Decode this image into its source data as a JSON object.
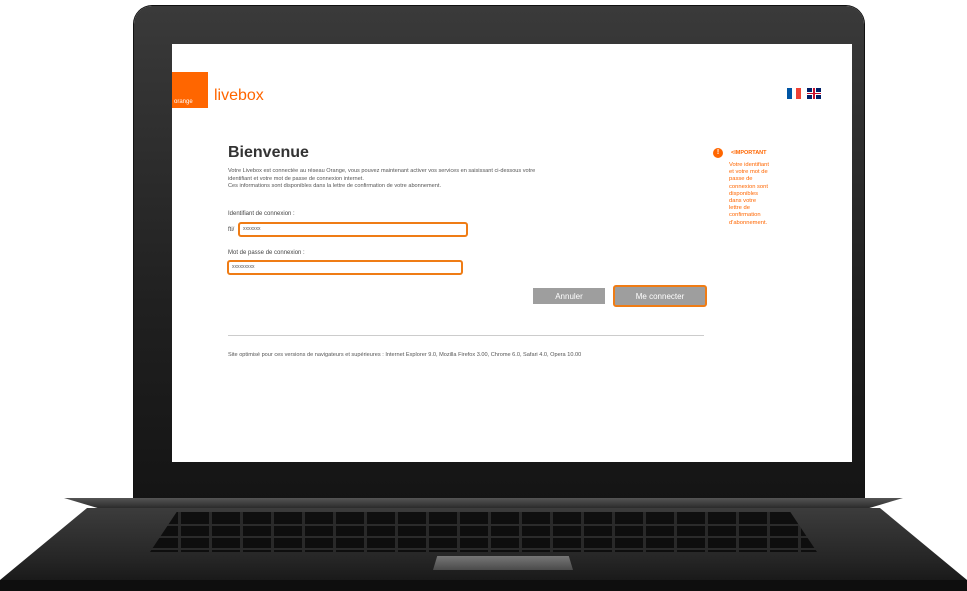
{
  "header": {
    "logo_text": "orange",
    "brand": "livebox",
    "flags": [
      "flag-fr-icon",
      "flag-uk-icon"
    ]
  },
  "main": {
    "title": "Bienvenue",
    "intro_lines": [
      "Votre Livebox est connectée au réseau Orange, vous pouvez maintenant activer vos services en saisissant ci-dessous votre",
      "identifiant et votre mot de passe de connexion internet.",
      "Ces informations sont disponibles dans la lettre de confirmation de votre abonnement."
    ],
    "login_label": "Identifiant de connexion :",
    "login_prefix": "fti/",
    "login_value": "xxxxxxx",
    "password_label": "Mot de passe de connexion :",
    "password_value": "xxxxxxxxx",
    "cancel_label": "Annuler",
    "connect_label": "Me connecter",
    "footer_note": "Site optimisé pour ces versions de navigateurs et supérieures : Internet Explorer 9.0, Mozilla Firefox 3.00, Chrome 6.0, Safari 4.0, Opera 10.00"
  },
  "sidebar": {
    "title": "<IMPORTANT",
    "text_lines": [
      "Votre identifiant",
      "et votre mot de",
      "passe de",
      "connexion sont",
      "disponibles",
      "dans votre",
      "lettre de",
      "confirmation",
      "d'abonnement."
    ]
  },
  "colors": {
    "accent": "#ff6600",
    "field_border": "#ef7c15",
    "button_bg": "#9e9e9e"
  }
}
